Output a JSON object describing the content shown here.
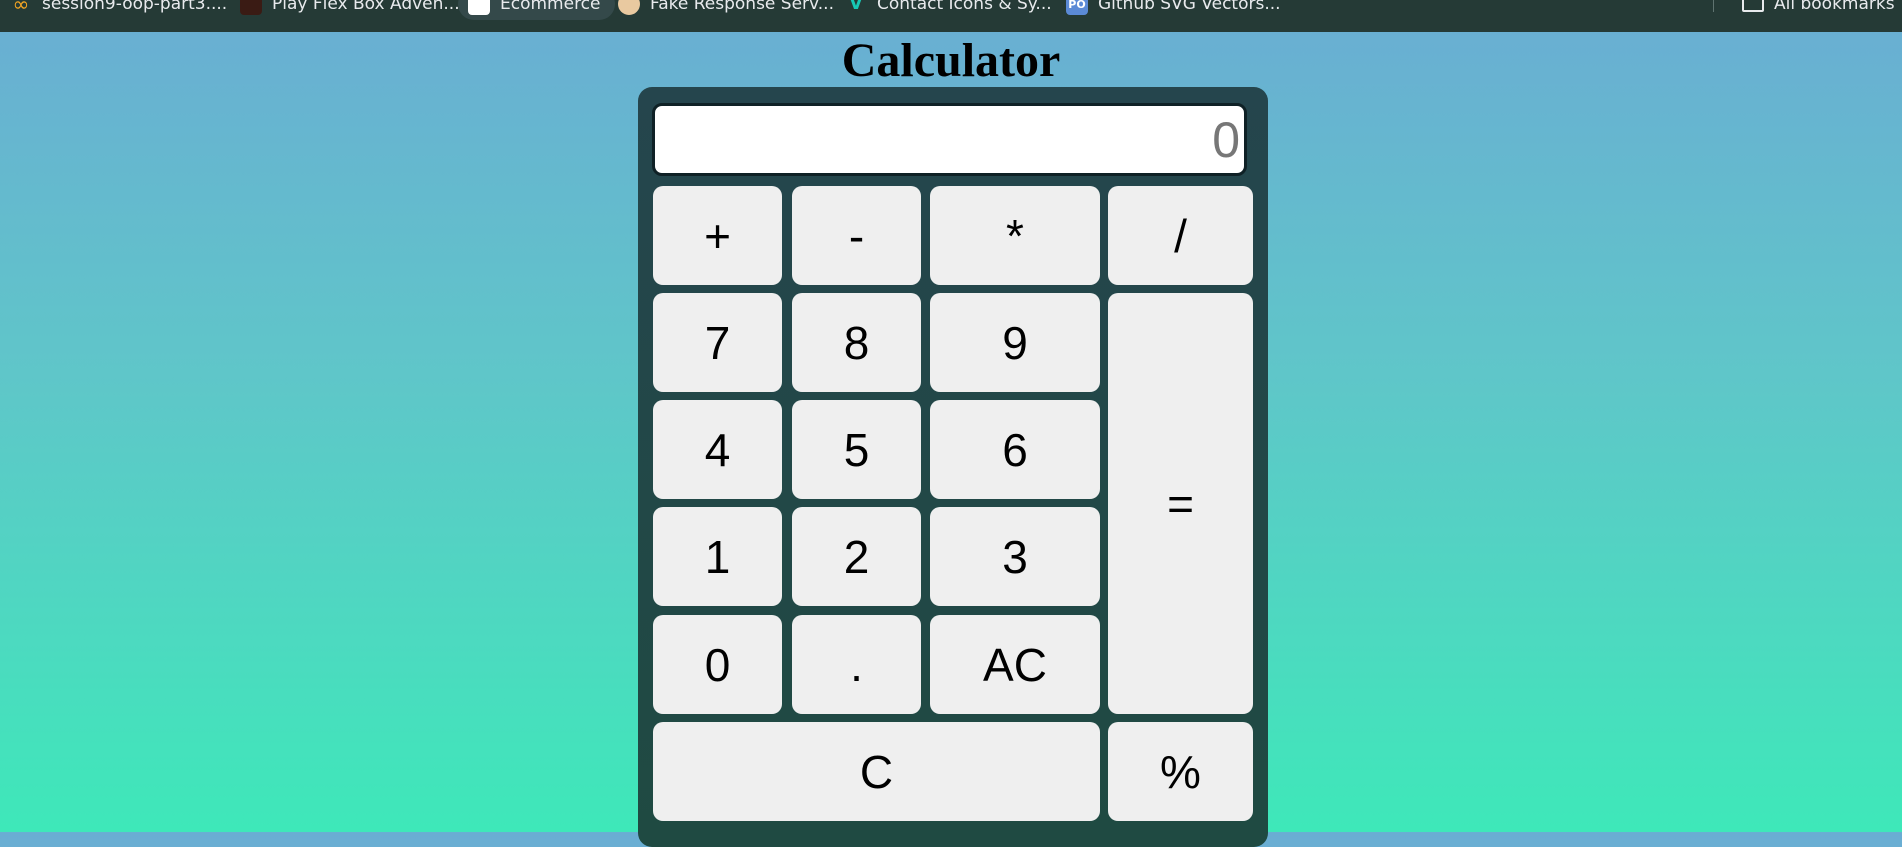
{
  "bookmarks_bar": {
    "items": [
      {
        "label": "session9-oop-part3....",
        "icon": "infinity-icon",
        "color": "#f5a623"
      },
      {
        "label": "Play Flex Box Adven...",
        "icon": "game-icon",
        "color": "#3a1b14"
      },
      {
        "label": "Ecommerce",
        "icon": "box-icon",
        "color": "#ffffff"
      },
      {
        "label": "Fake Response Serv...",
        "icon": "avatar-icon",
        "color": "#e9c9a0"
      },
      {
        "label": "Contact Icons & Sy...",
        "icon": "v-logo-icon",
        "color": "#17c7b4"
      },
      {
        "label": "Github SVG Vectors...",
        "icon": "po-icon",
        "color": "#5b8ad6",
        "badge": "PO"
      }
    ],
    "all_bookmarks": "All bookmarks"
  },
  "page": {
    "title": "Calculator"
  },
  "calculator": {
    "display_placeholder": "0",
    "display_value": "",
    "keys": {
      "add": "+",
      "subtract": "-",
      "multiply": "*",
      "divide": "/",
      "seven": "7",
      "eight": "8",
      "nine": "9",
      "four": "4",
      "five": "5",
      "six": "6",
      "one": "1",
      "two": "2",
      "three": "3",
      "zero": "0",
      "dot": ".",
      "all_clear": "AC",
      "equals": "=",
      "clear": "C",
      "percent": "%"
    }
  },
  "colors": {
    "bookmarks_bar_bg": "#253a36",
    "calculator_bg": "#25454d",
    "key_bg": "#efefef",
    "gradient_top": "#6aadd3",
    "gradient_bottom": "#3ee8b9"
  }
}
